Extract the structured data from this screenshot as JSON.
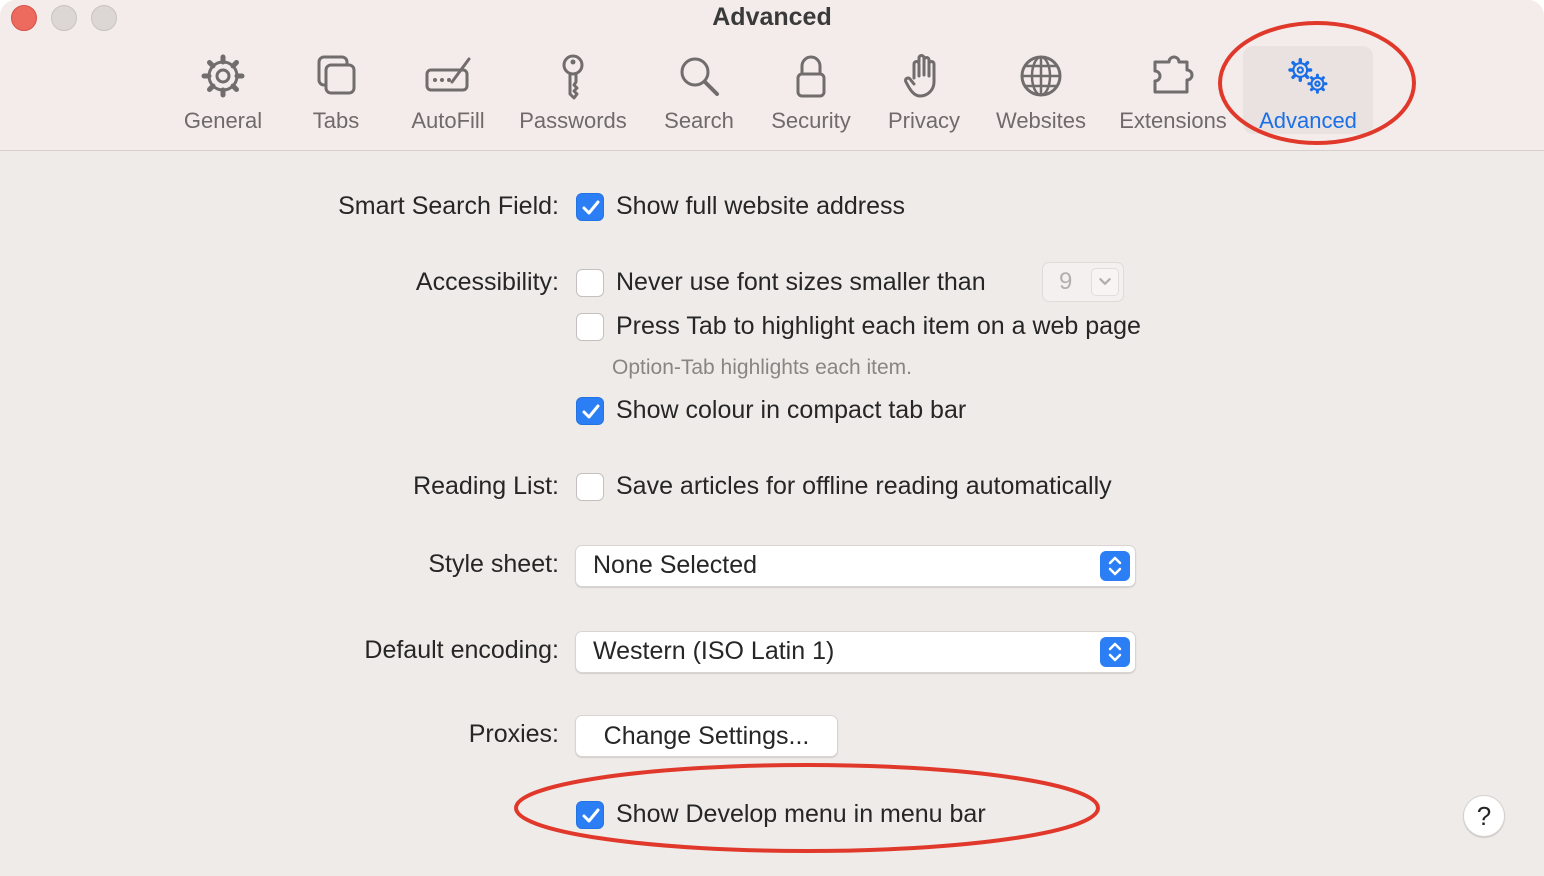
{
  "window": {
    "title": "Advanced"
  },
  "toolbar": {
    "tabs": [
      {
        "label": "General",
        "icon": "gear-icon"
      },
      {
        "label": "Tabs",
        "icon": "tabs-icon"
      },
      {
        "label": "AutoFill",
        "icon": "autofill-icon"
      },
      {
        "label": "Passwords",
        "icon": "key-icon"
      },
      {
        "label": "Search",
        "icon": "search-icon"
      },
      {
        "label": "Security",
        "icon": "lock-icon"
      },
      {
        "label": "Privacy",
        "icon": "hand-icon"
      },
      {
        "label": "Websites",
        "icon": "globe-icon"
      },
      {
        "label": "Extensions",
        "icon": "puzzle-icon"
      },
      {
        "label": "Advanced",
        "icon": "gears-icon",
        "selected": true
      }
    ]
  },
  "settings": {
    "smart_search": {
      "label": "Smart Search Field:",
      "option": "Show full website address",
      "checked": true
    },
    "accessibility": {
      "label": "Accessibility:",
      "font_size": {
        "text": "Never use font sizes smaller than",
        "checked": false,
        "value": "9"
      },
      "press_tab": {
        "text": "Press Tab to highlight each item on a web page",
        "checked": false,
        "hint": "Option-Tab highlights each item."
      },
      "show_colour": {
        "text": "Show colour in compact tab bar",
        "checked": true
      }
    },
    "reading_list": {
      "label": "Reading List:",
      "option": "Save articles for offline reading automatically",
      "checked": false
    },
    "style_sheet": {
      "label": "Style sheet:",
      "value": "None Selected"
    },
    "default_encoding": {
      "label": "Default encoding:",
      "value": "Western (ISO Latin 1)"
    },
    "proxies": {
      "label": "Proxies:",
      "button": "Change Settings..."
    },
    "develop_menu": {
      "option": "Show Develop menu in menu bar",
      "checked": true
    }
  },
  "help": {
    "label": "?"
  },
  "colors": {
    "accent": "#2b7ef4",
    "annotation": "#e0392b",
    "selected_tab_text": "#1a6fe6"
  }
}
